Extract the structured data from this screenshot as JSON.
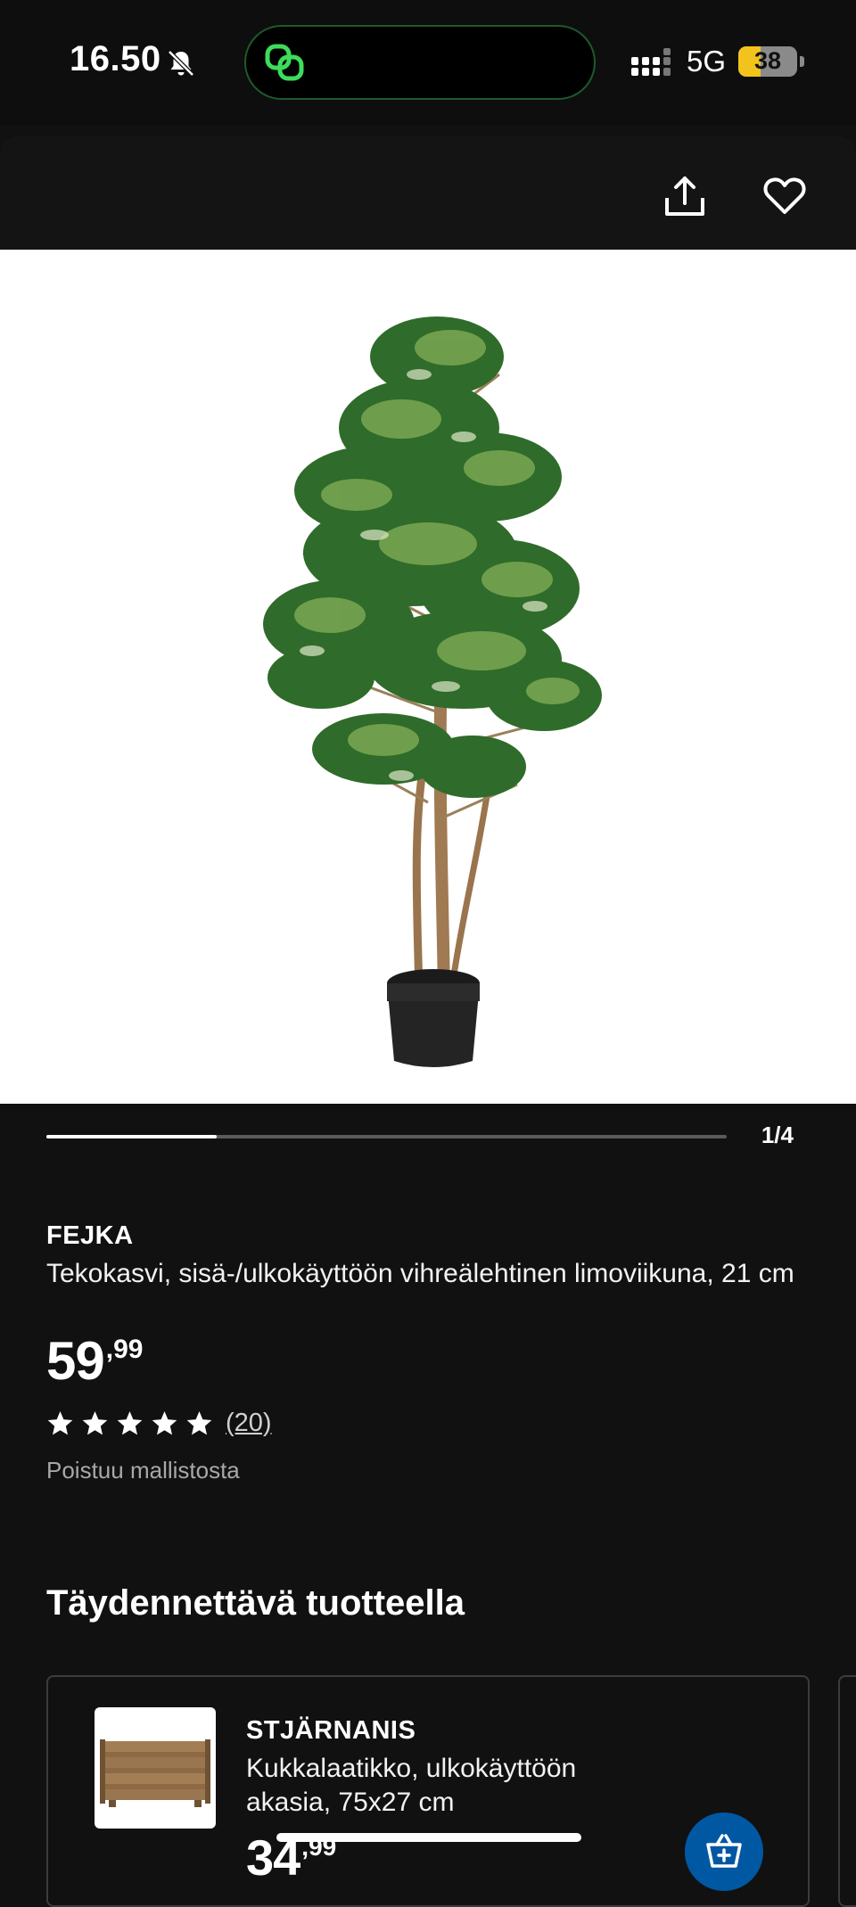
{
  "status_bar": {
    "time": "16.50",
    "network": "5G",
    "battery_level": "38",
    "battery_percent": 38,
    "battery_color": "#f2c31c",
    "island_icon": "link-rings-icon",
    "bell_icon": "bell-slash-icon"
  },
  "header": {
    "share_icon": "share-icon",
    "favourite_icon": "heart-icon"
  },
  "gallery": {
    "image_alt": "",
    "counter": "1/4",
    "progress": 0.25
  },
  "product": {
    "brand": "FEJKA",
    "description": "Tekokasvi, sisä-/ulkokäyttöön vihreälehtinen limoviikuna, 21 cm",
    "price_int": "59",
    "price_dec": ",99",
    "rating_stars": 5,
    "review_count": "(20)",
    "availability": "Poistuu mallistosta"
  },
  "complements": {
    "title": "Täydennettävä tuotteella",
    "items": [
      {
        "brand": "STJÄRNANIS",
        "description": "Kukkalaatikko, ulkokäyttöön akasia, 75x27 cm",
        "price_int": "34",
        "price_dec": ",99",
        "add_icon": "add-to-cart-icon"
      }
    ]
  },
  "colors": {
    "background": "#111112",
    "accent": "#0058a3",
    "status_bar": "#0e0e0e"
  }
}
